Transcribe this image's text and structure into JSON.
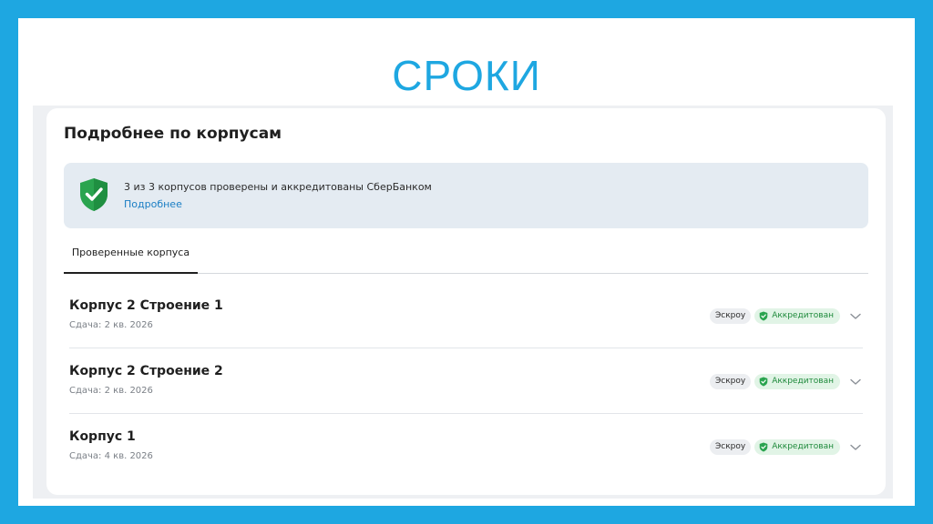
{
  "slide": {
    "title": "СРОКИ"
  },
  "card": {
    "heading": "Подробнее по корпусам",
    "info": {
      "text": "3 из 3 корпусов проверены и аккредитованы СберБанком",
      "link": "Подробнее",
      "icon": "shield-check-icon"
    },
    "tabs": [
      {
        "label": "Проверенные корпуса",
        "active": true
      }
    ],
    "buildings": [
      {
        "name": "Корпус 2 Строение 1",
        "delivery": "Сдача: 2 кв. 2026",
        "escrow": "Эскроу",
        "status": "Аккредитован"
      },
      {
        "name": "Корпус 2 Строение 2",
        "delivery": "Сдача: 2 кв. 2026",
        "escrow": "Эскроу",
        "status": "Аккредитован"
      },
      {
        "name": "Корпус 1",
        "delivery": "Сдача: 4 кв. 2026",
        "escrow": "Эскроу",
        "status": "Аккредитован"
      }
    ]
  },
  "colors": {
    "frame": "#1ea7e1",
    "accent_green": "#1f8a3c",
    "link_blue": "#1a7ec4"
  }
}
